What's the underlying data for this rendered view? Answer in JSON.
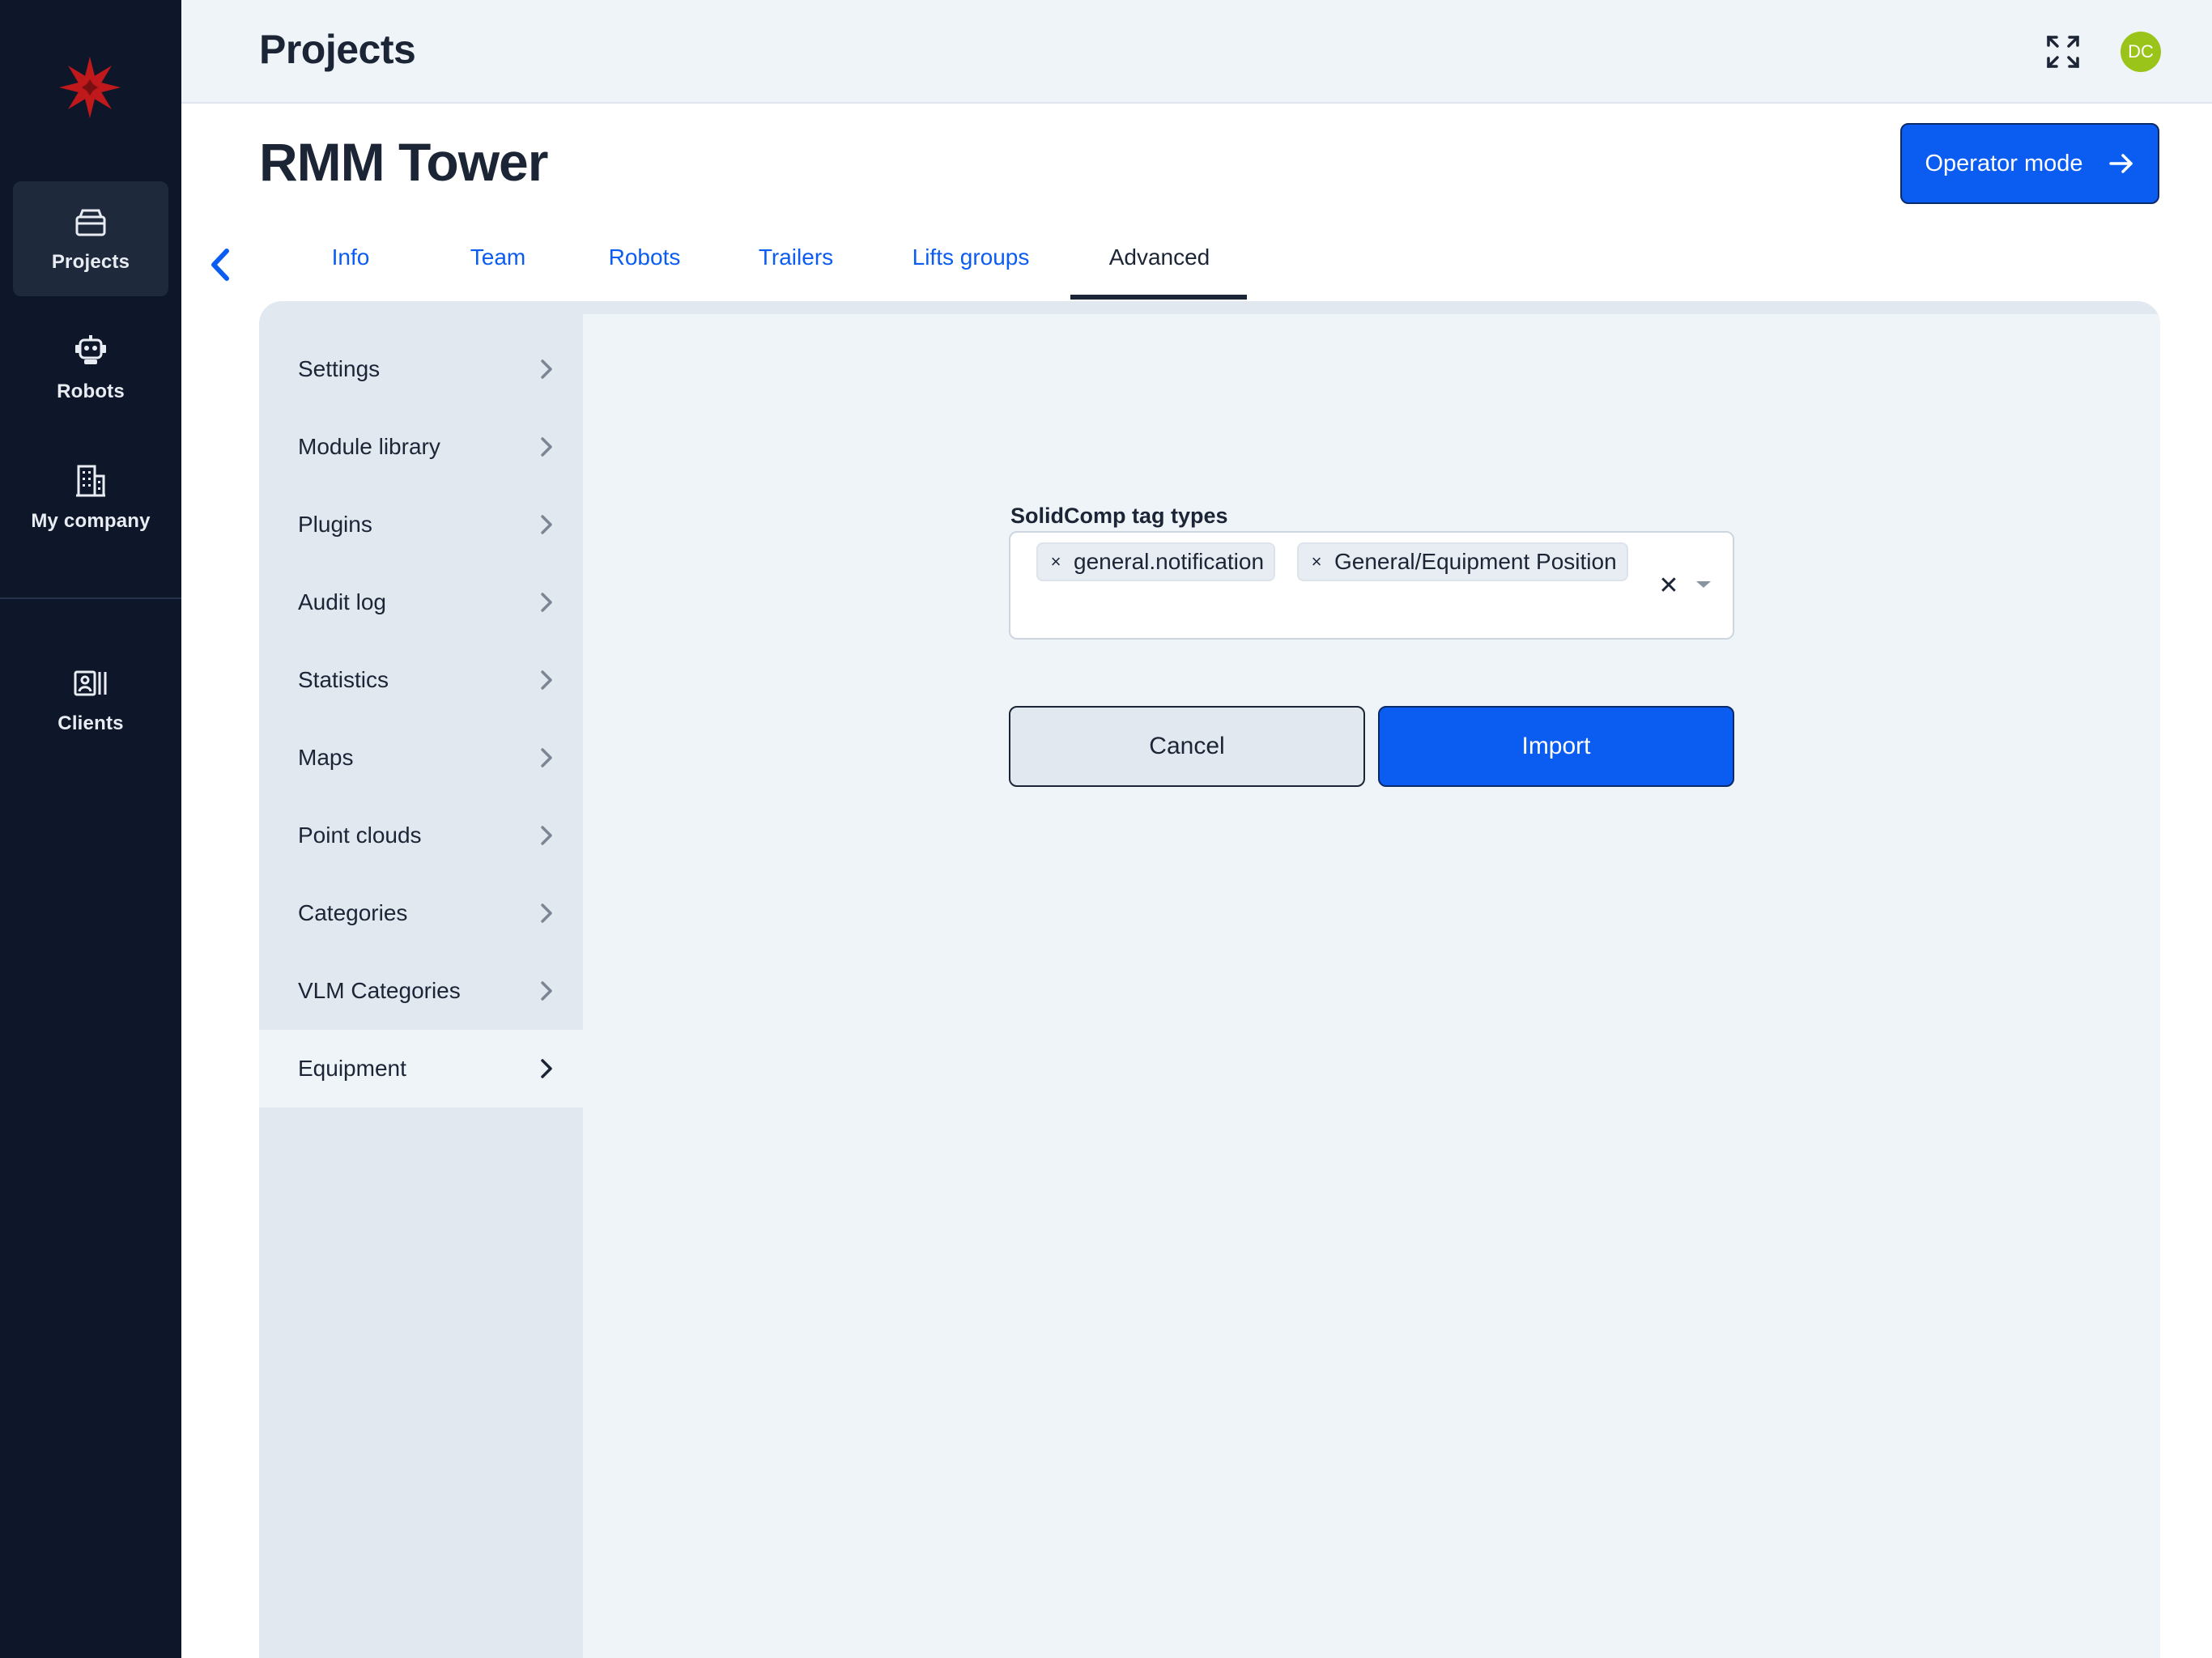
{
  "nav": {
    "items": [
      {
        "label": "Projects",
        "icon": "projects-icon"
      },
      {
        "label": "Robots",
        "icon": "robot-icon"
      },
      {
        "label": "My company",
        "icon": "building-icon"
      },
      {
        "label": "Clients",
        "icon": "clients-icon"
      }
    ],
    "active": "Projects"
  },
  "topbar": {
    "title": "Projects",
    "avatar_initials": "DC"
  },
  "page": {
    "title": "RMM Tower",
    "operator_button": "Operator mode"
  },
  "tabs": [
    {
      "label": "Info"
    },
    {
      "label": "Team"
    },
    {
      "label": "Robots"
    },
    {
      "label": "Trailers"
    },
    {
      "label": "Lifts groups"
    },
    {
      "label": "Advanced"
    }
  ],
  "active_tab": "Advanced",
  "side_menu": [
    {
      "label": "Settings"
    },
    {
      "label": "Module library"
    },
    {
      "label": "Plugins"
    },
    {
      "label": "Audit log"
    },
    {
      "label": "Statistics"
    },
    {
      "label": "Maps"
    },
    {
      "label": "Point clouds"
    },
    {
      "label": "Categories"
    },
    {
      "label": "VLM Categories"
    },
    {
      "label": "Equipment"
    }
  ],
  "active_menu": "Equipment",
  "form": {
    "field_label": "SolidComp tag types",
    "selected_tags": [
      "general.notification",
      "General/Equipment Position"
    ],
    "chip_remove_glyph": "×",
    "clear_glyph": "✕",
    "cancel_label": "Cancel",
    "import_label": "Import"
  },
  "colors": {
    "accent": "#0b5cf0",
    "rail_bg": "#0e172a",
    "avatar_bg": "#9bc41a",
    "logo": "#c0191b"
  }
}
